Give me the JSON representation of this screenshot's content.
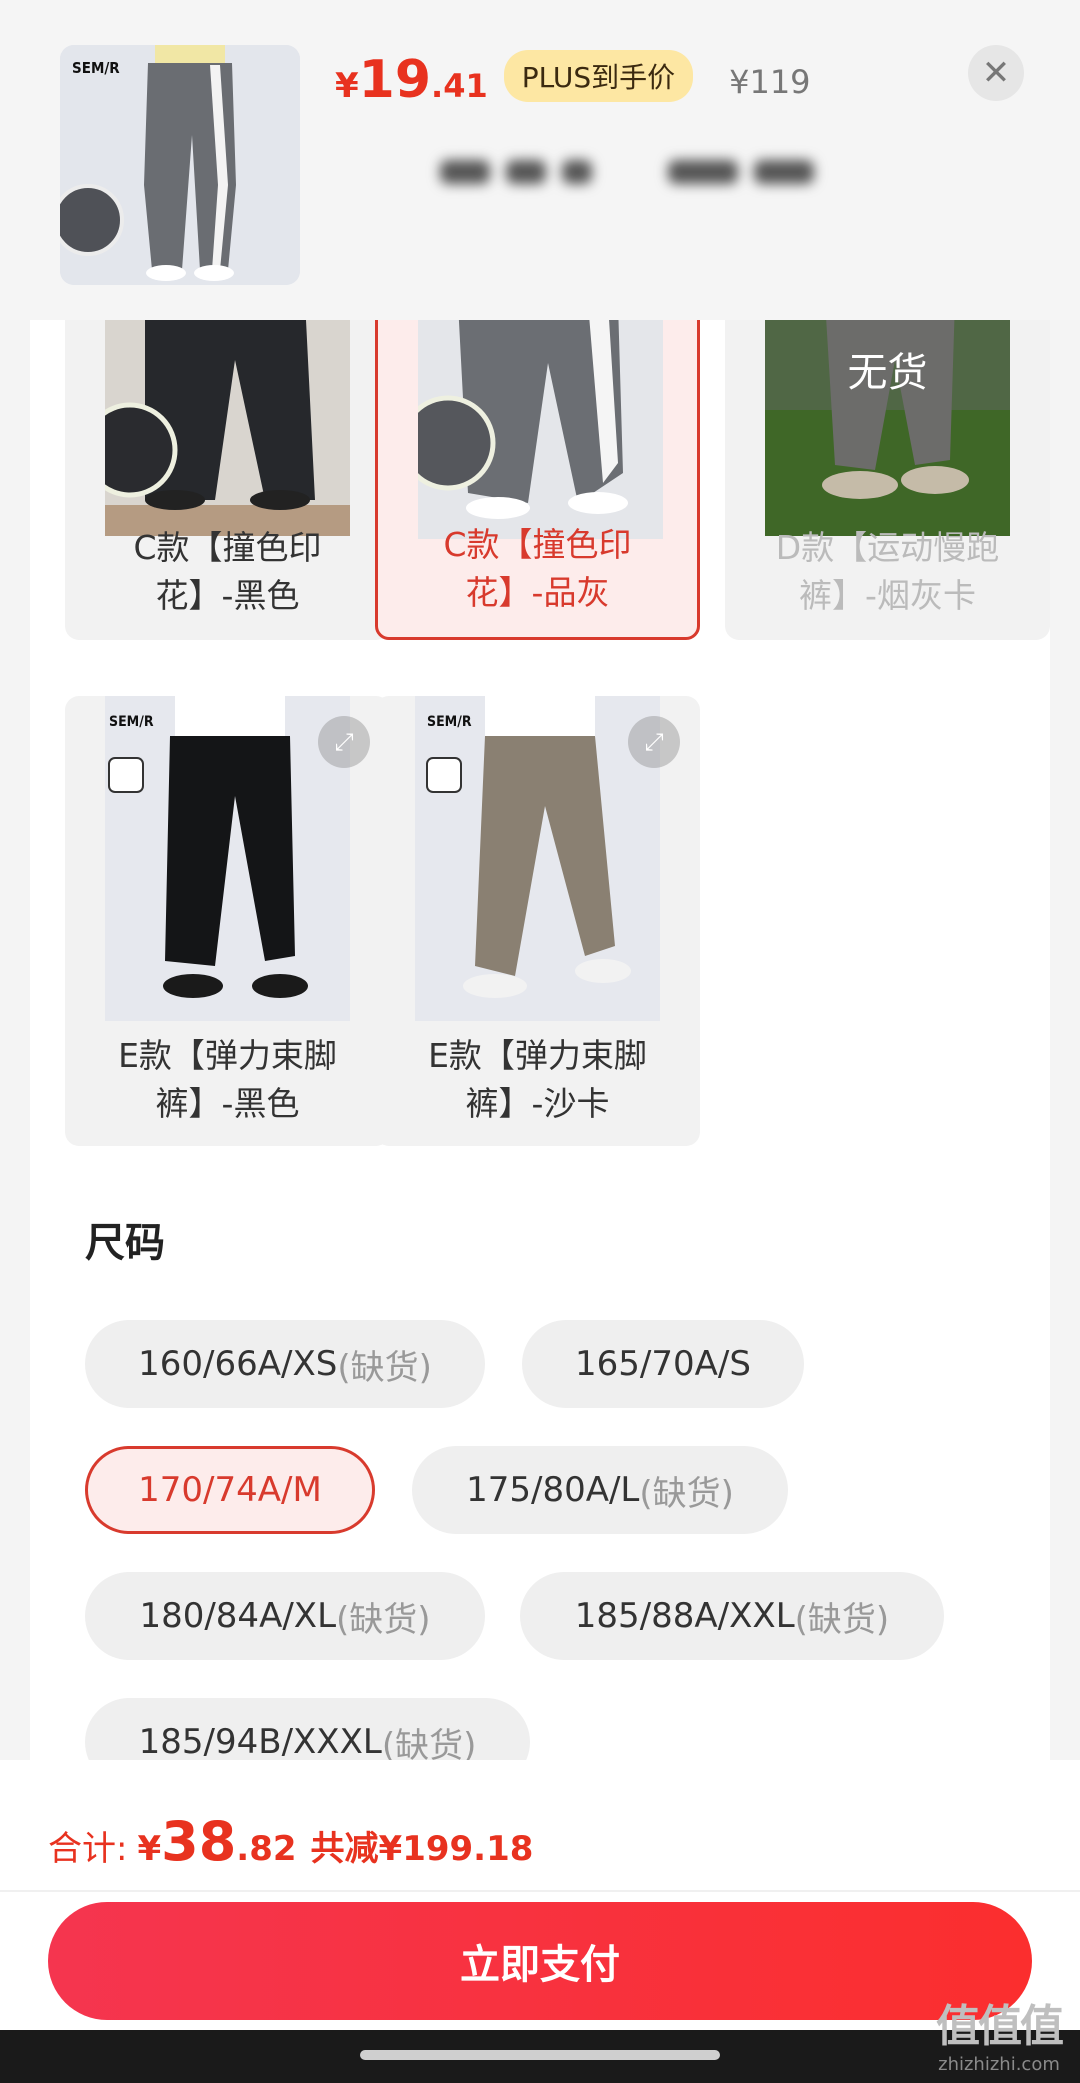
{
  "header": {
    "brand": "SEM/R",
    "price_currency": "¥",
    "price_int": "19",
    "price_dec": ".41",
    "plus_label": "PLUS到手价",
    "original_price": "¥119",
    "close_icon": "close-icon"
  },
  "variants": [
    {
      "label": "C款【撞色印花】-黑色",
      "color": "black",
      "state": "normal"
    },
    {
      "label": "C款【撞色印花】-品灰",
      "color": "gray",
      "state": "selected"
    },
    {
      "label": "D款【运动慢跑裤】-烟灰卡",
      "color": "gray",
      "state": "disabled",
      "badge": "无货"
    },
    {
      "label": "E款【弹力束脚裤】-黑色",
      "color": "black",
      "state": "normal"
    },
    {
      "label": "E款【弹力束脚裤】-沙卡",
      "color": "khaki",
      "state": "normal"
    }
  ],
  "size_section": {
    "title": "尺码",
    "options": [
      {
        "main": "160/66A/XS",
        "note": "(缺货)"
      },
      {
        "main": "165/70A/S",
        "note": ""
      },
      {
        "main": "170/74A/M",
        "note": "",
        "selected": true
      },
      {
        "main": "175/80A/L",
        "note": "(缺货)"
      },
      {
        "main": "180/84A/XL",
        "note": "(缺货)"
      },
      {
        "main": "185/88A/XXL",
        "note": "(缺货)"
      },
      {
        "main": "185/94B/XXXL",
        "note": "(缺货)"
      }
    ]
  },
  "footer": {
    "total_label": "合计:",
    "total_currency": "¥",
    "total_int": "38",
    "total_dec": ".82",
    "savings": "共减¥199.18",
    "pay_button": "立即支付"
  },
  "watermark": {
    "big": "值值值",
    "small": "zhizhizhi.com"
  },
  "colors": {
    "accent_red": "#e8321f",
    "plus_badge_bg": "#fde7a3",
    "pay_button": "#f5354f"
  }
}
